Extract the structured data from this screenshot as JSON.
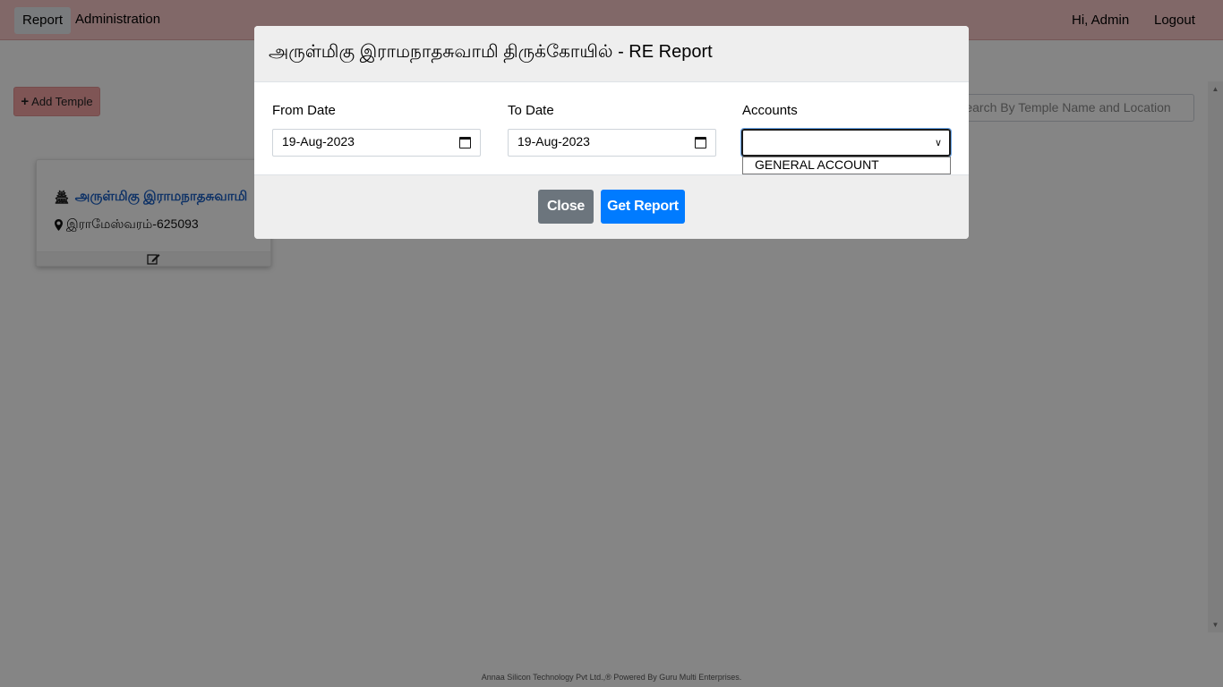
{
  "navbar": {
    "report_label": "Report",
    "admin_label": "Administration",
    "greeting": "Hi, Admin",
    "logout_label": "Logout"
  },
  "toolbar": {
    "add_temple_label": "Add Temple",
    "search_placeholder": "Search By Temple Name and Location"
  },
  "temple_card": {
    "name": "அருள்மிகு இராமநாதசுவாமி",
    "location": "இராமேஸ்வரம்-625093"
  },
  "modal": {
    "title": "அருள்மிகு இராமநாதசுவாமி திருக்கோயில் - RE Report",
    "from_date_label": "From Date",
    "from_date_value": "19-Aug-2023",
    "to_date_label": "To Date",
    "to_date_value": "19-Aug-2023",
    "accounts_label": "Accounts",
    "accounts_value": "",
    "accounts_options": [
      "GENERAL ACCOUNT"
    ],
    "close_label": "Close",
    "get_report_label": "Get Report"
  },
  "footer": {
    "text": "Annaa Silicon Technology Pvt Ltd.,® Powered By  Guru Multi Enterprises."
  },
  "colors": {
    "navbar_bg": "#f8c8c8",
    "primary": "#007bff",
    "secondary": "#6c757d",
    "add_button_bg": "#f3a3a3",
    "link": "#1a5fc4"
  }
}
